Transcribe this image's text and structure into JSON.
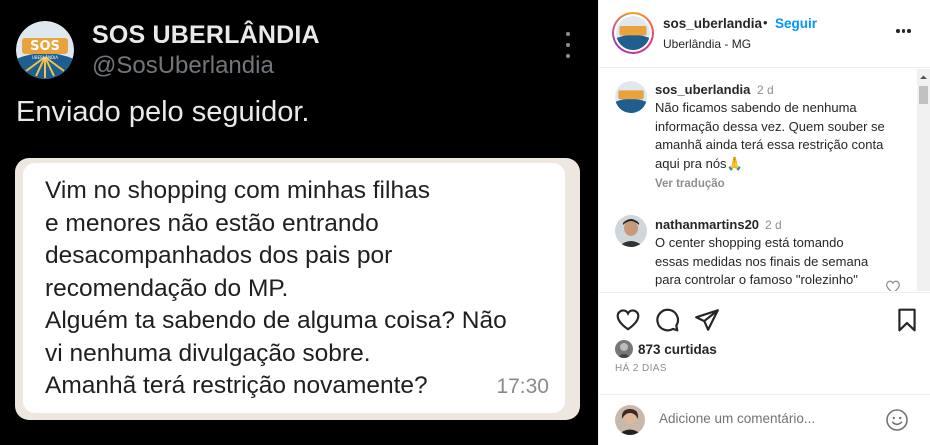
{
  "post": {
    "author_name": "SOS UBERLÂNDIA",
    "author_handle": "@SosUberlandia",
    "logo_text": "SOS",
    "logo_subtext": "UBERLÂNDIA",
    "body": "Enviado pelo seguidor.",
    "message": "Vim no shopping com minhas filhas\ne menores não estão entrando\ndesacompanhados dos pais por\nrecomendação do MP.\nAlguém ta sabendo de alguma coisa? Não\nvi nenhuma divulgação sobre.\nAmanhã terá restrição novamente?",
    "message_time": "17:30"
  },
  "header": {
    "username": "sos_uberlandia",
    "dot": "•",
    "follow_label": "Seguir",
    "location": "Uberlândia - MG"
  },
  "comments": [
    {
      "username": "sos_uberlandia",
      "time": "2 d",
      "text": "Não ficamos sabendo de nenhuma\ninformação dessa vez. Quem souber se\namanhã ainda terá essa restrição conta\naqui pra nós🙏",
      "translate_label": "Ver tradução"
    },
    {
      "username": "nathanmartins20",
      "time": "2 d",
      "text": "O center shopping está tomando\nessas medidas nos finais de semana\npara controlar o famoso \"rolezinho\""
    }
  ],
  "likes": "873 curtidas",
  "posted_ago": "HÁ 2 DIAS",
  "add_comment_placeholder": "Adicione um comentário...",
  "icons": [
    "heart-icon",
    "comment-icon",
    "share-icon",
    "bookmark-icon",
    "emoji-icon",
    "more-icon"
  ],
  "colors": {
    "follow_blue": "#0095f6",
    "image_bg": "#000000",
    "bubble_bg": "#ffffff"
  }
}
